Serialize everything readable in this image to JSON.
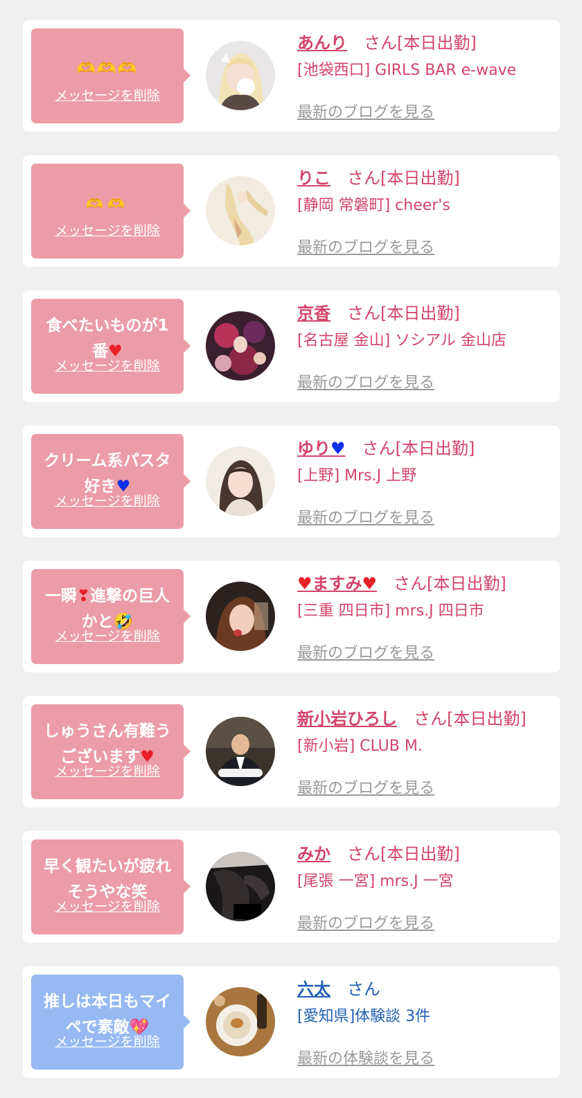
{
  "colors": {
    "page_bg": "#f0f0f0",
    "card_bg": "#ffffff",
    "pink_bubble": "#ec9ca6",
    "blue_bubble": "#97b9f3",
    "name_pink": "#d2446a",
    "name_blue": "#2260b4",
    "link_gray": "#999999"
  },
  "delete_label": "メッセージを削除",
  "cards": [
    {
      "message": "🫶🫶🫶",
      "name": "あんり",
      "suffix": "さん[本日出勤]",
      "shop": "[池袋西口] GIRLS BAR e-wave",
      "link": "最新のブログを見る"
    },
    {
      "message": "🫶🫶",
      "name": "りこ",
      "suffix": "さん[本日出勤]",
      "shop": "[静岡 常磐町] cheer's",
      "link": "最新のブログを見る"
    },
    {
      "message_a": "食べたいものが1",
      "message_b": "番",
      "message_emoji": "♥",
      "name": "京香",
      "suffix": "さん[本日出勤]",
      "shop": "[名古屋 金山] ソシアル 金山店",
      "link": "最新のブログを見る"
    },
    {
      "message_a": "クリーム系パスタ",
      "message_b": "好き",
      "message_emoji": "♥",
      "name": "ゆり",
      "name_emoji": "♥",
      "suffix": "さん[本日出勤]",
      "shop": "[上野] Mrs.J 上野",
      "link": "最新のブログを見る"
    },
    {
      "message_a": "一瞬",
      "message_a_emoji": "❣",
      "message_a2": "進撃の巨人",
      "message_b": "かと",
      "message_emoji": "🤣",
      "name_emoji": "♥",
      "name": "ますみ",
      "suffix": "さん[本日出勤]",
      "shop": "[三重 四日市] mrs.J 四日市",
      "link": "最新のブログを見る"
    },
    {
      "message_a": "しゅうさん有難う",
      "message_b": "ございます",
      "message_emoji": "♥",
      "name": "新小岩ひろし",
      "suffix": "さん[本日出勤]",
      "shop": "[新小岩] CLUB M.",
      "link": "最新のブログを見る"
    },
    {
      "message_a": "早く観たいが疲れ",
      "message_b": "そうやな笑",
      "name": "みか",
      "suffix": "さん[本日出勤]",
      "shop": "[尾張 一宮] mrs.J 一宮",
      "link": "最新のブログを見る"
    },
    {
      "message_a": "推しは本日もマイ",
      "message_b": "ペで素敵",
      "message_emoji": "💖",
      "name": "六太",
      "suffix": "さん",
      "shop": "[愛知県]体験談 3件",
      "link": "最新の体験談を見る"
    }
  ]
}
